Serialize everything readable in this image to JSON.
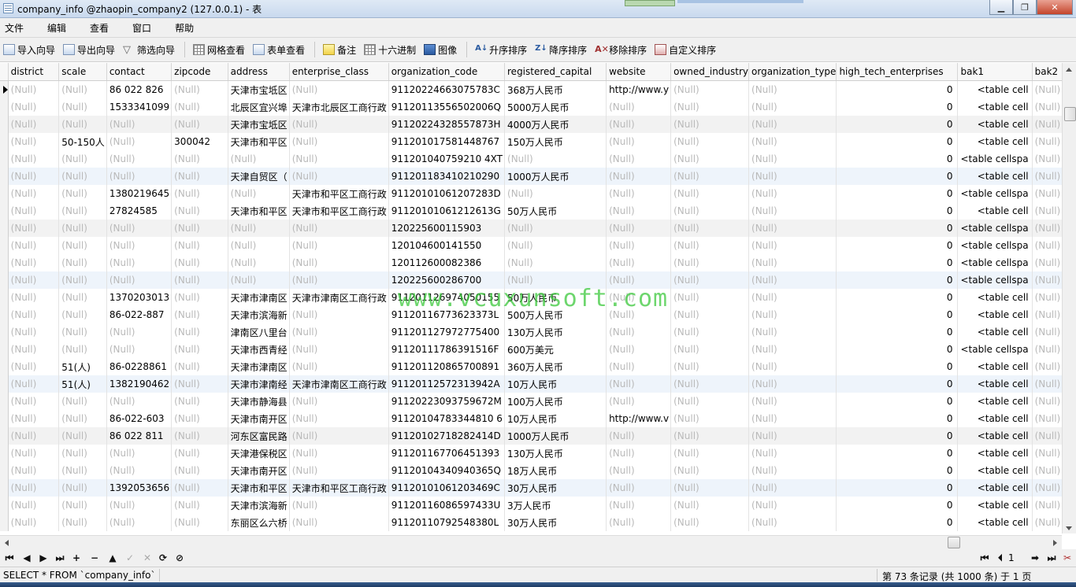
{
  "window": {
    "title": "company_info @zhaopin_company2 (127.0.0.1) - 表",
    "minimize": "▁",
    "maximize": "❐",
    "close": "✕"
  },
  "menu": [
    "文件",
    "编辑",
    "查看",
    "窗口",
    "帮助"
  ],
  "toolbar": {
    "import_wizard": "导入向导",
    "export_wizard": "导出向导",
    "filter_wizard": "筛选向导",
    "grid_view": "网格查看",
    "form_view": "表单查看",
    "memo": "备注",
    "hex": "十六进制",
    "image": "图像",
    "sort_asc": "升序排序",
    "sort_desc": "降序排序",
    "remove_sort": "移除排序",
    "custom_sort": "自定义排序"
  },
  "columns": [
    "district",
    "scale",
    "contact",
    "zipcode",
    "address",
    "enterprise_class",
    "organization_code",
    "registered_capital",
    "website",
    "owned_industry",
    "organization_type",
    "high_tech_enterprises",
    "bak1",
    "bak2"
  ],
  "rows": [
    [
      "(Null)",
      "(Null)",
      "86 022  826",
      "(Null)",
      "天津市宝坻区",
      "(Null)",
      "91120224663075783C",
      "368万人民币",
      "http://www.y",
      "(Null)",
      "(Null)",
      "0",
      "<table cell",
      "(Null)"
    ],
    [
      "(Null)",
      "(Null)",
      "1533341099",
      "(Null)",
      "北辰区宜兴埠",
      "天津市北辰区工商行政",
      "91120113556502006Q",
      "5000万人民币",
      "(Null)",
      "(Null)",
      "(Null)",
      "0",
      "<table cell",
      "(Null)"
    ],
    [
      "(Null)",
      "(Null)",
      "(Null)",
      "(Null)",
      "天津市宝坻区",
      "(Null)",
      "91120224328557873H",
      "4000万人民币",
      "(Null)",
      "(Null)",
      "(Null)",
      "0",
      "<table cell",
      "(Null)"
    ],
    [
      "(Null)",
      "50-150人",
      "(Null)",
      "300042",
      "天津市和平区",
      "(Null)",
      "911201017581448767",
      "150万人民币",
      "(Null)",
      "(Null)",
      "(Null)",
      "0",
      "<table cell",
      "(Null)"
    ],
    [
      "(Null)",
      "(Null)",
      "(Null)",
      "(Null)",
      "(Null)",
      "(Null)",
      "911201040759210 4XT",
      "(Null)",
      "(Null)",
      "(Null)",
      "(Null)",
      "0",
      "<table cellspa",
      "(Null)"
    ],
    [
      "(Null)",
      "(Null)",
      "(Null)",
      "(Null)",
      "天津自贸区（",
      "(Null)",
      "911201183410210290",
      "1000万人民币",
      "(Null)",
      "(Null)",
      "(Null)",
      "0",
      "<table cell",
      "(Null)"
    ],
    [
      "(Null)",
      "(Null)",
      "1380219645",
      "(Null)",
      "(Null)",
      "天津市和平区工商行政",
      "91120101061207283D",
      "(Null)",
      "(Null)",
      "(Null)",
      "(Null)",
      "0",
      "<table cellspa",
      "(Null)"
    ],
    [
      "(Null)",
      "(Null)",
      "27824585",
      "(Null)",
      "天津市和平区",
      "天津市和平区工商行政",
      "91120101061212613G",
      "50万人民币",
      "(Null)",
      "(Null)",
      "(Null)",
      "0",
      "<table cell",
      "(Null)"
    ],
    [
      "(Null)",
      "(Null)",
      "(Null)",
      "(Null)",
      "(Null)",
      "(Null)",
      "120225600115903",
      "(Null)",
      "(Null)",
      "(Null)",
      "(Null)",
      "0",
      "<table cellspa",
      "(Null)"
    ],
    [
      "(Null)",
      "(Null)",
      "(Null)",
      "(Null)",
      "(Null)",
      "(Null)",
      "120104600141550",
      "(Null)",
      "(Null)",
      "(Null)",
      "(Null)",
      "0",
      "<table cellspa",
      "(Null)"
    ],
    [
      "(Null)",
      "(Null)",
      "(Null)",
      "(Null)",
      "(Null)",
      "(Null)",
      "120112600082386",
      "(Null)",
      "(Null)",
      "(Null)",
      "(Null)",
      "0",
      "<table cellspa",
      "(Null)"
    ],
    [
      "(Null)",
      "(Null)",
      "(Null)",
      "(Null)",
      "(Null)",
      "(Null)",
      "120225600286700",
      "(Null)",
      "(Null)",
      "(Null)",
      "(Null)",
      "0",
      "<table cellspa",
      "(Null)"
    ],
    [
      "(Null)",
      "(Null)",
      "1370203013",
      "(Null)",
      "天津市津南区",
      "天津市津南区工商行政",
      "911201126974050155",
      "50万人民币",
      "(Null)",
      "(Null)",
      "(Null)",
      "0",
      "<table cell",
      "(Null)"
    ],
    [
      "(Null)",
      "(Null)",
      "86-022-887",
      "(Null)",
      "天津市滨海新",
      "(Null)",
      "91120116773623373L",
      "500万人民币",
      "(Null)",
      "(Null)",
      "(Null)",
      "0",
      "<table cell",
      "(Null)"
    ],
    [
      "(Null)",
      "(Null)",
      "(Null)",
      "(Null)",
      "津南区八里台",
      "(Null)",
      "911201127972775400",
      "130万人民币",
      "(Null)",
      "(Null)",
      "(Null)",
      "0",
      "<table cell",
      "(Null)"
    ],
    [
      "(Null)",
      "(Null)",
      "(Null)",
      "(Null)",
      "天津市西青经",
      "(Null)",
      "91120111786391516F",
      "600万美元",
      "(Null)",
      "(Null)",
      "(Null)",
      "0",
      "<table cellspa",
      "(Null)"
    ],
    [
      "(Null)",
      "51(人)",
      "86-0228861",
      "(Null)",
      "天津市津南区",
      "(Null)",
      "911201120865700891",
      "360万人民币",
      "(Null)",
      "(Null)",
      "(Null)",
      "0",
      "<table cell",
      "(Null)"
    ],
    [
      "(Null)",
      "51(人)",
      "1382190462",
      "(Null)",
      "天津市津南经",
      "天津市津南区工商行政",
      "91120112572313942A",
      "10万人民币",
      "(Null)",
      "(Null)",
      "(Null)",
      "0",
      "<table cell",
      "(Null)"
    ],
    [
      "(Null)",
      "(Null)",
      "(Null)",
      "(Null)",
      "天津市静海县",
      "(Null)",
      "91120223093759672M",
      "100万人民币",
      "(Null)",
      "(Null)",
      "(Null)",
      "0",
      "<table cell",
      "(Null)"
    ],
    [
      "(Null)",
      "(Null)",
      "86-022-603",
      "(Null)",
      "天津市南开区",
      "(Null)",
      "91120104783344810 6",
      "10万人民币",
      "http://www.v",
      "(Null)",
      "(Null)",
      "0",
      "<table cell",
      "(Null)"
    ],
    [
      "(Null)",
      "(Null)",
      "86 022  811",
      "(Null)",
      "河东区富民路",
      "(Null)",
      "91120102718282414D",
      "1000万人民币",
      "(Null)",
      "(Null)",
      "(Null)",
      "0",
      "<table cell",
      "(Null)"
    ],
    [
      "(Null)",
      "(Null)",
      "(Null)",
      "(Null)",
      "天津港保税区",
      "(Null)",
      "911201167706451393",
      "130万人民币",
      "(Null)",
      "(Null)",
      "(Null)",
      "0",
      "<table cell",
      "(Null)"
    ],
    [
      "(Null)",
      "(Null)",
      "(Null)",
      "(Null)",
      "天津市南开区",
      "(Null)",
      "91120104340940365Q",
      "18万人民币",
      "(Null)",
      "(Null)",
      "(Null)",
      "0",
      "<table cell",
      "(Null)"
    ],
    [
      "(Null)",
      "(Null)",
      "1392053656",
      "(Null)",
      "天津市和平区",
      "天津市和平区工商行政",
      "91120101061203469C",
      "30万人民币",
      "(Null)",
      "(Null)",
      "(Null)",
      "0",
      "<table cell",
      "(Null)"
    ],
    [
      "(Null)",
      "(Null)",
      "(Null)",
      "(Null)",
      "天津市滨海新",
      "(Null)",
      "91120116086597433U",
      "3万人民币",
      "(Null)",
      "(Null)",
      "(Null)",
      "0",
      "<table cell",
      "(Null)"
    ],
    [
      "(Null)",
      "(Null)",
      "(Null)",
      "(Null)",
      "东丽区么六桥",
      "(Null)",
      "91120110792548380L",
      "30万人民币",
      "(Null)",
      "(Null)",
      "(Null)",
      "0",
      "<table cell",
      "(Null)"
    ]
  ],
  "watermark": "www.vcuxunsoft.com",
  "navigator": {
    "first": "⏮",
    "prev": "◀",
    "next": "▶",
    "last": "⏭",
    "add": "+",
    "delete": "−",
    "up": "▲",
    "apply": "✓",
    "refresh": "⟳",
    "stop": "⊘",
    "page_first": "⏮",
    "page_prev": "⏴",
    "page": "1",
    "page_next": "➡",
    "page_last": "⏭",
    "settings": "✂"
  },
  "status": {
    "sql": "SELECT * FROM `company_info` LI",
    "records": "第 73 条记录 (共 1000 条) 于 1 页"
  }
}
